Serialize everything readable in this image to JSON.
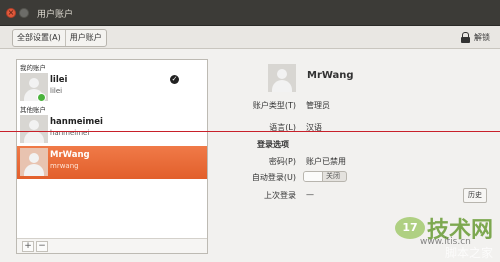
{
  "window": {
    "title": "用户账户"
  },
  "toolbar": {
    "breadcrumbs": [
      "全部设置(A)",
      "用户账户"
    ],
    "unlock_label": "解锁"
  },
  "userlist": {
    "my_account_label": "我的账户",
    "other_accounts_label": "其他账户",
    "users": [
      {
        "name": "lilei",
        "login": "lilei"
      },
      {
        "name": "hanmeimei",
        "login": "hanmeimei"
      },
      {
        "name": "MrWang",
        "login": "mrwang"
      }
    ],
    "add_symbol": "+",
    "remove_symbol": "−"
  },
  "detail": {
    "name": "MrWang",
    "account_type_label": "账户类型(T)",
    "account_type_value": "管理员",
    "language_label": "语言(L)",
    "language_value": "汉语",
    "login_options_heading": "登录选项",
    "password_label": "密码(P)",
    "password_value": "账户已禁用",
    "autologin_label": "自动登录(U)",
    "autologin_value": "关闭",
    "last_login_label": "上次登录",
    "last_login_value": "—",
    "history_button": "历史"
  },
  "watermark": {
    "logo": "17",
    "text": "技术网",
    "url": "www.itis.cn",
    "brand": "脚本之家"
  },
  "colors": {
    "selected_row": "#e8693a",
    "online_status": "#4ab33c",
    "guide_line": "#c8202a",
    "titlebar": "#3c3b37"
  }
}
